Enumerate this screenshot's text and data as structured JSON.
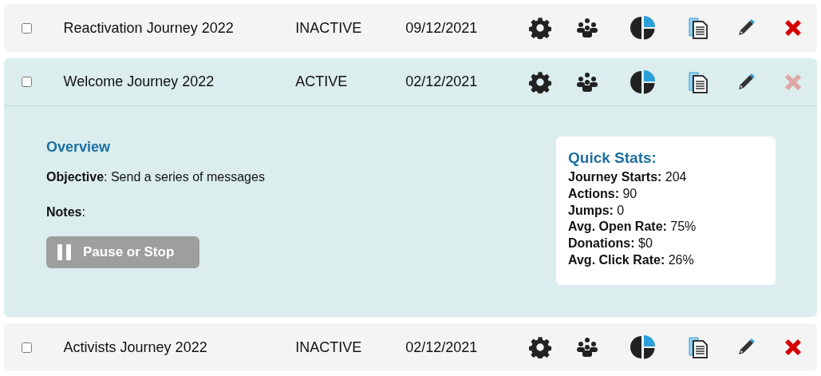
{
  "journeys": [
    {
      "name": "Reactivation Journey 2022",
      "status": "INACTIVE",
      "date": "09/12/2021",
      "checked": false,
      "expanded": false,
      "delete_disabled": false
    },
    {
      "name": "Welcome Journey 2022",
      "status": "ACTIVE",
      "date": "02/12/2021",
      "checked": false,
      "expanded": true,
      "delete_disabled": true,
      "details": {
        "overview_title": "Overview",
        "objective": "**Objective**: Send a series of messages",
        "notes": "**Notes**:",
        "pause_button": "Pause or Stop",
        "stats_title": "Quick Stats:",
        "stats": [
          "**Journey Starts:** 204",
          "**Actions:** 90",
          "**Jumps:** 0",
          "**Avg. Open Rate:** 75%",
          "**Donations:** $0",
          "**Avg. Click Rate:** 26%"
        ]
      }
    },
    {
      "name": "Activists Journey 2022",
      "status": "INACTIVE",
      "date": "02/12/2021",
      "checked": false,
      "expanded": false,
      "delete_disabled": false
    }
  ]
}
